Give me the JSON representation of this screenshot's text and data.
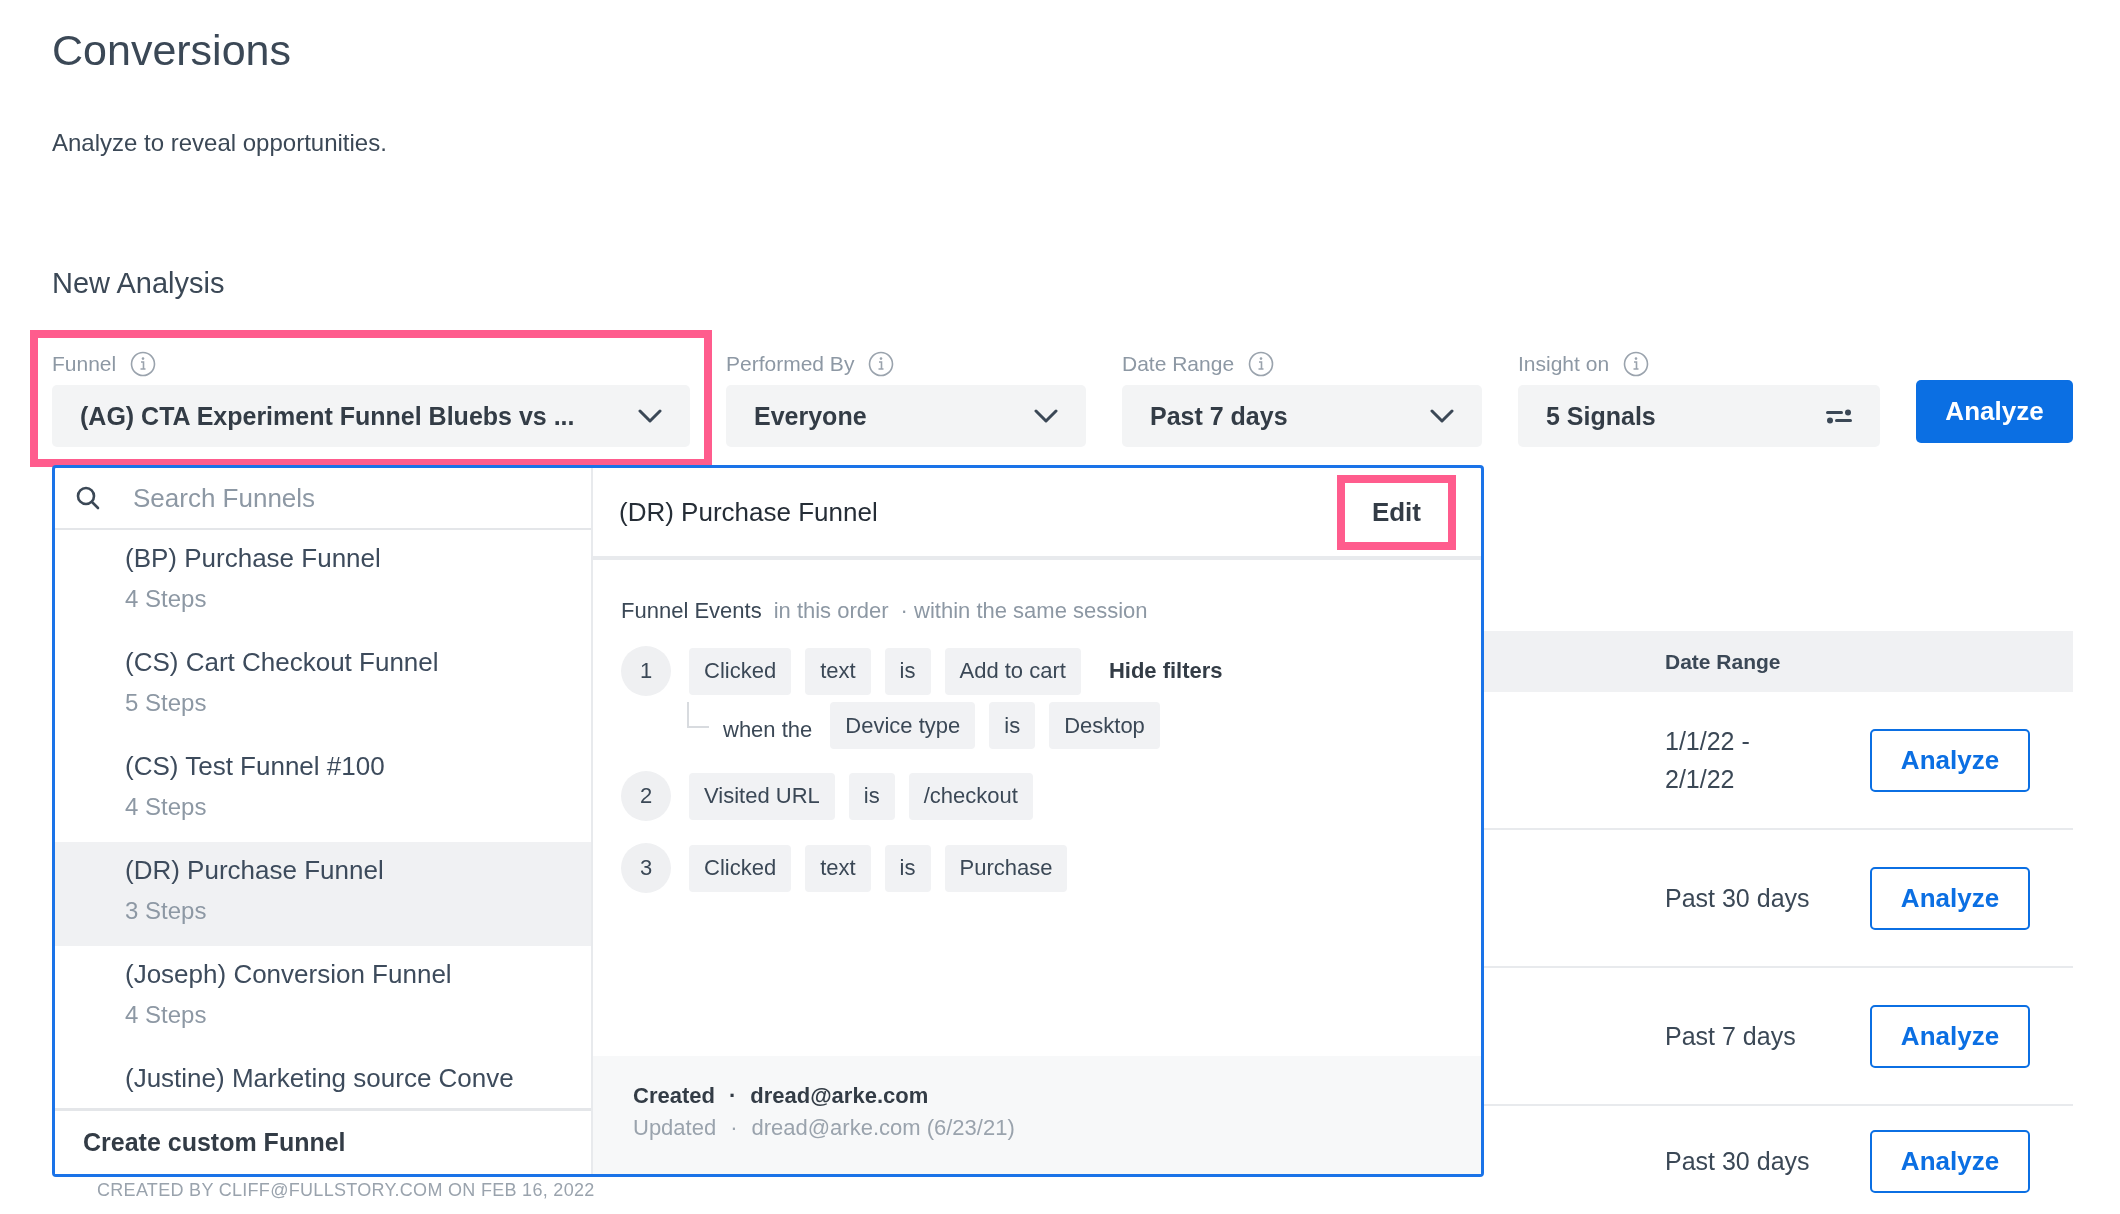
{
  "page": {
    "title": "Conversions",
    "subtitle": "Analyze to reveal opportunities."
  },
  "new_analysis": {
    "heading": "New Analysis",
    "fields": [
      {
        "label": "Funnel",
        "value": "(AG) CTA Experiment Funnel Bluebs vs ...",
        "kind": "dropdown",
        "highlighted": true
      },
      {
        "label": "Performed By",
        "value": "Everyone",
        "kind": "dropdown"
      },
      {
        "label": "Date Range",
        "value": "Past 7 days",
        "kind": "dropdown"
      },
      {
        "label": "Insight on",
        "value": "5 Signals",
        "kind": "signals"
      }
    ],
    "analyze_button": "Analyze"
  },
  "funnel_menu": {
    "search": {
      "placeholder": "Search Funnels"
    },
    "items": [
      {
        "name": "(BP) Purchase Funnel",
        "steps": "4 Steps",
        "selected": false
      },
      {
        "name": "(CS) Cart Checkout Funnel",
        "steps": "5 Steps",
        "selected": false
      },
      {
        "name": "(CS) Test Funnel #100",
        "steps": "4 Steps",
        "selected": false
      },
      {
        "name": "(DR) Purchase Funnel",
        "steps": "3 Steps",
        "selected": true
      },
      {
        "name": "(Joseph) Conversion Funnel",
        "steps": "4 Steps",
        "selected": false
      },
      {
        "name": "(Justine) Marketing source Conve",
        "selected": false
      }
    ],
    "create_button": "Create custom Funnel"
  },
  "funnel_detail": {
    "title": "(DR) Purchase Funnel",
    "edit_button": {
      "label": "Edit",
      "highlighted": true
    },
    "events_label": "Funnel Events",
    "order": "in this order",
    "session": "· within the same session",
    "steps": [
      {
        "number": "1",
        "tokens": [
          "Clicked",
          "text",
          "is",
          "Add to cart"
        ],
        "toggle": "Hide filters",
        "filter": {
          "prefix": "when the",
          "tokens": [
            "Device type",
            "is",
            "Desktop"
          ]
        }
      },
      {
        "number": "2",
        "tokens": [
          "Visited URL",
          "is",
          "/checkout"
        ]
      },
      {
        "number": "3",
        "tokens": [
          "Clicked",
          "text",
          "is",
          "Purchase"
        ]
      }
    ],
    "created": {
      "label": "Created",
      "separator": "·",
      "by": "dread@arke.com"
    },
    "updated": {
      "label": "Updated",
      "separator": "·",
      "by": "dread@arke.com (6/23/21)"
    }
  },
  "table": {
    "columns": [
      "Date Range"
    ],
    "rows": [
      {
        "date_range": "1/1/22 - 2/1/22",
        "action": "Analyze"
      },
      {
        "date_range": "Past 30 days",
        "action": "Analyze"
      },
      {
        "date_range": "Past 7 days",
        "action": "Analyze"
      },
      {
        "date_range": "Past 30 days",
        "action": "Analyze"
      }
    ]
  },
  "footer_note": "CREATED BY CLIFF@FULLSTORY.COM ON FEB 16, 2022"
}
